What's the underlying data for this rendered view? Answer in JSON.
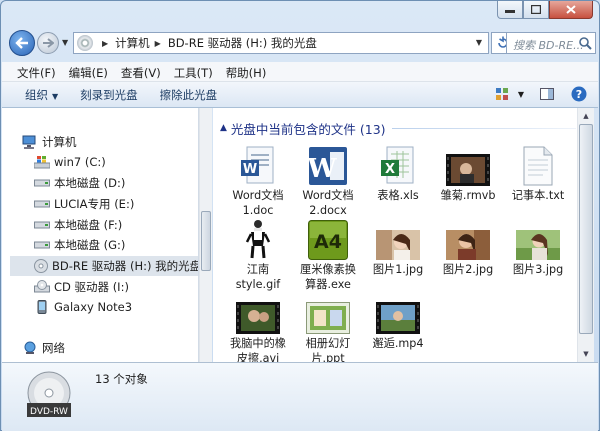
{
  "window": {
    "caption_buttons": [
      "minimize",
      "maximize",
      "close"
    ]
  },
  "address": {
    "crumbs": [
      "计算机",
      "BD-RE 驱动器 (H:) 我的光盘"
    ],
    "search_placeholder": "搜索 BD-RE..."
  },
  "menu": [
    "文件(F)",
    "编辑(E)",
    "查看(V)",
    "工具(T)",
    "帮助(H)"
  ],
  "commands": {
    "organize": "组织",
    "burn": "刻录到光盘",
    "erase": "擦除此光盘"
  },
  "nav": {
    "computer": "计算机",
    "items": [
      {
        "label": "win7 (C:)",
        "icon": "windows-drive-icon"
      },
      {
        "label": "本地磁盘 (D:)",
        "icon": "hard-drive-icon"
      },
      {
        "label": "LUCIA专用 (E:)",
        "icon": "hard-drive-icon"
      },
      {
        "label": "本地磁盘 (F:)",
        "icon": "hard-drive-icon"
      },
      {
        "label": "本地磁盘 (G:)",
        "icon": "hard-drive-icon"
      },
      {
        "label": "BD-RE 驱动器 (H:) 我的光盘",
        "icon": "optical-disc-icon",
        "selected": true
      },
      {
        "label": "CD 驱动器 (I:)",
        "icon": "cd-drive-icon"
      },
      {
        "label": "Galaxy Note3",
        "icon": "phone-icon"
      }
    ],
    "network": "网络"
  },
  "content": {
    "group_title": "光盘中当前包含的文件 (13)",
    "files": [
      {
        "name": "Word文档1.doc",
        "lines": [
          "Word文档",
          "1.doc"
        ],
        "icon": "word-doc-icon"
      },
      {
        "name": "Word文档2.docx",
        "lines": [
          "Word文档",
          "2.docx"
        ],
        "icon": "word-docx-icon"
      },
      {
        "name": "表格.xls",
        "lines": [
          "表格.xls"
        ],
        "icon": "excel-icon"
      },
      {
        "name": "雏菊.rmvb",
        "lines": [
          "雏菊.rmvb"
        ],
        "icon": "video-thumbnail-icon"
      },
      {
        "name": "记事本.txt",
        "lines": [
          "记事本.txt"
        ],
        "icon": "text-file-icon"
      },
      {
        "name": "江南style.gif",
        "lines": [
          "江南",
          "style.gif"
        ],
        "icon": "gif-thumbnail-icon"
      },
      {
        "name": "厘米像素换算器.exe",
        "lines": [
          "厘米像素换",
          "算器.exe"
        ],
        "icon": "exe-a4-icon"
      },
      {
        "name": "图片1.jpg",
        "lines": [
          "图片1.jpg"
        ],
        "icon": "photo-thumbnail-icon"
      },
      {
        "name": "图片2.jpg",
        "lines": [
          "图片2.jpg"
        ],
        "icon": "photo-thumbnail-icon"
      },
      {
        "name": "图片3.jpg",
        "lines": [
          "图片3.jpg"
        ],
        "icon": "photo-thumbnail-icon"
      },
      {
        "name": "我脑中的橡皮擦.avi",
        "lines": [
          "我脑中的橡",
          "皮擦.avi"
        ],
        "icon": "video-thumbnail-icon"
      },
      {
        "name": "相册幻灯片.ppt",
        "lines": [
          "相册幻灯",
          "片.ppt"
        ],
        "icon": "ppt-thumbnail-icon"
      },
      {
        "name": "邂逅.mp4",
        "lines": [
          "邂逅.mp4"
        ],
        "icon": "video-thumbnail-icon"
      }
    ]
  },
  "details": {
    "status": "13 个对象",
    "disc_label": "DVD-RW"
  },
  "colors": {
    "accent": "#1e3287",
    "selected": "#dde4ec",
    "word": "#2b5797",
    "excel": "#1f7a3a",
    "a4": "#5a8a12"
  }
}
